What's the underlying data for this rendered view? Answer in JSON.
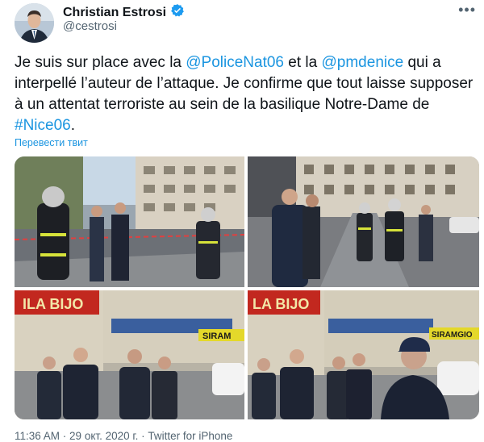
{
  "author": {
    "display_name": "Christian Estrosi",
    "handle": "@cestrosi"
  },
  "tweet": {
    "part1": "Je suis sur place avec la ",
    "mention1": "@PoliceNat06",
    "part2": " et la ",
    "mention2": "@pmdenice",
    "part3": " qui a interpellé l’auteur de l’attaque. Je confirme que tout laisse supposer à un attentat terroriste au sein de la basilique Notre-Dame de ",
    "hashtag": "#Nice06",
    "part4": "."
  },
  "translate_label": "Перевести твит",
  "photos": {
    "shop_sign_1": "ILA BIJO",
    "shop_sign_2": "LA BIJO",
    "store_sign_1": "SIRAM",
    "store_sign_2": "SIRAMGIO"
  },
  "footer": {
    "time": "11:36 AM",
    "sep1": " · ",
    "date": "29 окт. 2020 г.",
    "sep2": " · ",
    "source": "Twitter for iPhone"
  },
  "colors": {
    "link": "#1b95e0",
    "verified": "#1d9bf0",
    "secondary_text": "#536471"
  }
}
